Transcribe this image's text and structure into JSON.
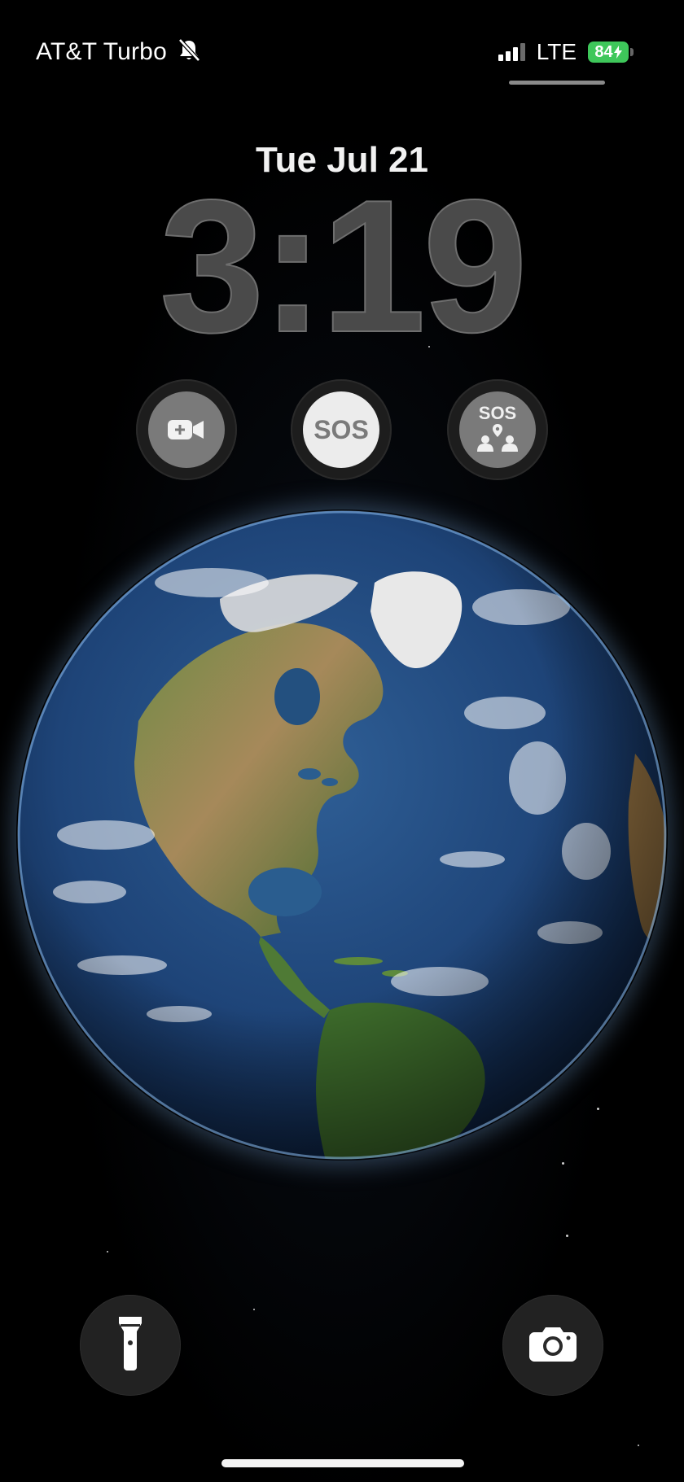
{
  "status_bar": {
    "carrier": "AT&T Turbo",
    "network_type": "LTE",
    "battery_level": "84",
    "signal_bars_active": 3,
    "signal_bars_total": 4,
    "silent_mode_icon": "bell-slash-icon",
    "battery_charging_icon": "bolt-icon",
    "battery_color": "#3ec75a"
  },
  "lock_screen": {
    "date": "Tue Jul 21",
    "time": "3:19"
  },
  "widgets": {
    "facetime_icon": "video-plus-icon",
    "sos_label": "SOS",
    "sos_contacts_label": "SOS",
    "sos_contacts_icon": "location-people-icon"
  },
  "bottom_controls": {
    "flashlight_icon": "flashlight-icon",
    "camera_icon": "camera-icon"
  },
  "wallpaper": {
    "subject": "earth-globe"
  }
}
